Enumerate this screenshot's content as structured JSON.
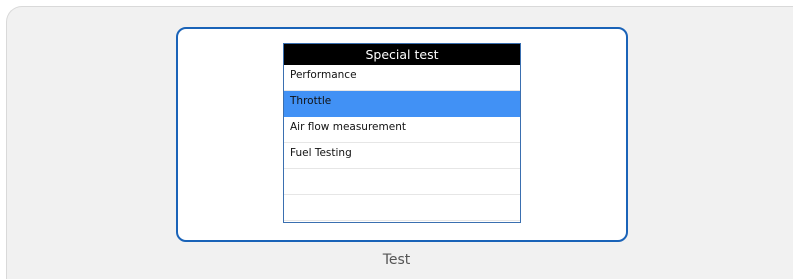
{
  "panel": {
    "title": "Special test",
    "items": [
      {
        "label": "Performance",
        "selected": false
      },
      {
        "label": "Throttle",
        "selected": true
      },
      {
        "label": "Air flow measurement",
        "selected": false
      },
      {
        "label": "Fuel Testing",
        "selected": false
      },
      {
        "label": "",
        "selected": false
      },
      {
        "label": "",
        "selected": false
      }
    ]
  },
  "caption": "Test",
  "colors": {
    "header_bg": "#000000",
    "selected_bg": "#4191f5",
    "frame_border": "#1a63b8",
    "outer_bg": "#f1f1f1"
  }
}
